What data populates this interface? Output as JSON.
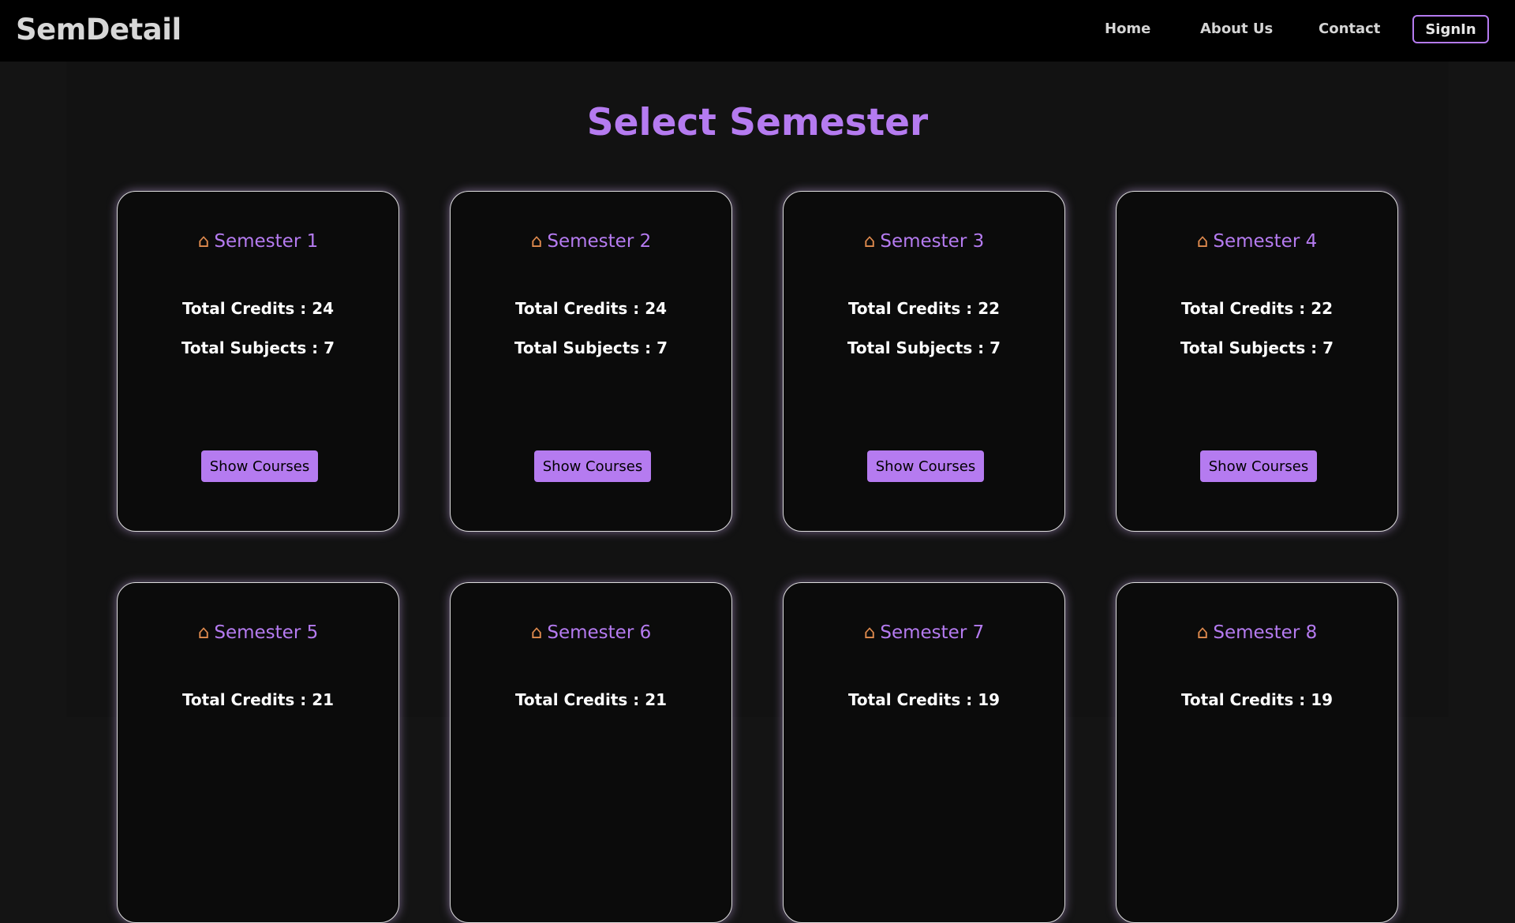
{
  "navbar": {
    "brand": "SemDetail",
    "links": [
      "Home",
      "About Us",
      "Contact"
    ],
    "signin_label": "SignIn"
  },
  "page": {
    "title": "Select Semester"
  },
  "semesters": [
    {
      "title": "Semester 1",
      "credits": "Total Credits : 24",
      "subjects": "Total Subjects : 7",
      "button": "Show Courses"
    },
    {
      "title": "Semester 2",
      "credits": "Total Credits : 24",
      "subjects": "Total Subjects : 7",
      "button": "Show Courses"
    },
    {
      "title": "Semester 3",
      "credits": "Total Credits : 22",
      "subjects": "Total Subjects : 7",
      "button": "Show Courses"
    },
    {
      "title": "Semester 4",
      "credits": "Total Credits : 22",
      "subjects": "Total Subjects : 7",
      "button": "Show Courses"
    },
    {
      "title": "Semester 5",
      "credits": "Total Credits : 21",
      "subjects": "",
      "button": ""
    },
    {
      "title": "Semester 6",
      "credits": "Total Credits : 21",
      "subjects": "",
      "button": ""
    },
    {
      "title": "Semester 7",
      "credits": "Total Credits : 19",
      "subjects": "",
      "button": ""
    },
    {
      "title": "Semester 8",
      "credits": "Total Credits : 19",
      "subjects": "",
      "button": ""
    }
  ],
  "icons": {
    "semester": "house-icon"
  },
  "colors": {
    "accent": "#b57bf0",
    "background": "#141414",
    "navbar": "#000000"
  }
}
